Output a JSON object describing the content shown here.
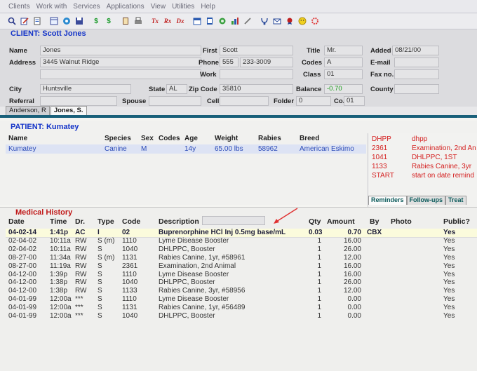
{
  "menu": [
    "Clients",
    "Work with",
    "Services",
    "Applications",
    "View",
    "Utilities",
    "Help"
  ],
  "toolbar": {
    "icons": [
      "search-icon",
      "edit-icon",
      "document-icon",
      "document-icon",
      "save-icon",
      "save-icon",
      "dollar-icon",
      "dollar-icon",
      "book-icon",
      "print-icon",
      "treatment-icon",
      "prescription-icon",
      "diagnosis-icon",
      "calendar-icon",
      "calendar-icon",
      "lab-icon",
      "chart-icon",
      "pen-icon",
      "stethoscope-icon",
      "email-icon",
      "award-icon",
      "smiley-icon",
      "settings-icon"
    ],
    "letters": {
      "s1": "$",
      "s2": "$",
      "tx": "Tx",
      "rx": "Rx",
      "dx": "Dx"
    }
  },
  "client": {
    "section_title": "CLIENT:",
    "client_name": "Scott Jones",
    "labels": {
      "name": "Name",
      "address": "Address",
      "city": "City",
      "state": "State",
      "zip": "Zip Code",
      "referral": "Referral",
      "spouse": "Spouse",
      "first": "First",
      "phone": "Phone",
      "work": "Work",
      "cell": "Cell",
      "title": "Title",
      "codes": "Codes",
      "class": "Class",
      "balance": "Balance",
      "folder": "Folder",
      "co": "Co.",
      "added": "Added",
      "email": "E-mail",
      "fax": "Fax no.",
      "county": "County"
    },
    "values": {
      "name": "Jones",
      "address": "3445 Walnut Ridge",
      "city": "Huntsville",
      "state": "AL",
      "zip": "35810",
      "first": "Scott",
      "phone_area": "555",
      "phone_num": "233-3009",
      "title": "Mr.",
      "codes": "A",
      "class": "01",
      "balance": "-0.70",
      "folder": "0",
      "co": "01",
      "added": "08/21/00"
    },
    "tabs": [
      "Anderson, R",
      "Jones, S."
    ]
  },
  "patient": {
    "section_title": "PATIENT:",
    "patient_name": "Kumatey",
    "headers": {
      "name": "Name",
      "species": "Species",
      "sex": "Sex",
      "codes": "Codes",
      "age": "Age",
      "weight": "Weight",
      "rabies": "Rabies",
      "breed": "Breed"
    },
    "row": {
      "name": "Kumatey",
      "species": "Canine",
      "sex": "M",
      "age": "14y",
      "weight": "65.00 lbs",
      "rabies": "58962",
      "breed": "American Eskimo"
    }
  },
  "reminders": {
    "items": [
      {
        "code": "DHPP",
        "desc": "dhpp"
      },
      {
        "code": "2361",
        "desc": "Examination, 2nd An"
      },
      {
        "code": "1041",
        "desc": "DHLPPC, 1ST"
      },
      {
        "code": "1133",
        "desc": "Rabies Canine, 3yr"
      },
      {
        "code": "START",
        "desc": "start on date remind"
      }
    ],
    "tabs": [
      "Reminders",
      "Follow-ups",
      "Treat"
    ]
  },
  "history": {
    "section_title": "Medical History",
    "headers": {
      "date": "Date",
      "time": "Time",
      "dr": "Dr.",
      "type": "Type",
      "code": "Code",
      "desc": "Description",
      "qty": "Qty",
      "amount": "Amount",
      "by": "By",
      "photo": "Photo",
      "public": "Public?"
    },
    "rows": [
      {
        "date": "04-02-14",
        "time": "1:41p",
        "dr": "AC",
        "type": "I",
        "code": "02",
        "desc": "Buprenorphine HCl Inj 0.5mg base/mL",
        "qty": "0.03",
        "amount": "0.70",
        "by": "CBX",
        "public": "Yes"
      },
      {
        "date": "02-04-02",
        "time": "10:11a",
        "dr": "RW",
        "type": "S (m)",
        "code": "1110",
        "desc": "Lyme Disease Booster",
        "qty": "1",
        "amount": "16.00",
        "by": "",
        "public": "Yes"
      },
      {
        "date": "02-04-02",
        "time": "10:11a",
        "dr": "RW",
        "type": "S",
        "code": "1040",
        "desc": "DHLPPC, Booster",
        "qty": "1",
        "amount": "26.00",
        "by": "",
        "public": "Yes"
      },
      {
        "date": "08-27-00",
        "time": "11:34a",
        "dr": "RW",
        "type": "S (m)",
        "code": "1131",
        "desc": "Rabies Canine, 1yr, #58961",
        "qty": "1",
        "amount": "12.00",
        "by": "",
        "public": "Yes"
      },
      {
        "date": "08-27-00",
        "time": "11:19a",
        "dr": "RW",
        "type": "S",
        "code": "2361",
        "desc": "Examination, 2nd Animal",
        "qty": "1",
        "amount": "16.00",
        "by": "",
        "public": "Yes"
      },
      {
        "date": "04-12-00",
        "time": "1:39p",
        "dr": "RW",
        "type": "S",
        "code": "1110",
        "desc": "Lyme Disease Booster",
        "qty": "1",
        "amount": "16.00",
        "by": "",
        "public": "Yes"
      },
      {
        "date": "04-12-00",
        "time": "1:38p",
        "dr": "RW",
        "type": "S",
        "code": "1040",
        "desc": "DHLPPC, Booster",
        "qty": "1",
        "amount": "26.00",
        "by": "",
        "public": "Yes"
      },
      {
        "date": "04-12-00",
        "time": "1:38p",
        "dr": "RW",
        "type": "S",
        "code": "1133",
        "desc": "Rabies Canine, 3yr, #58956",
        "qty": "1",
        "amount": "12.00",
        "by": "",
        "public": "Yes"
      },
      {
        "date": "04-01-99",
        "time": "12:00a",
        "dr": "***",
        "type": "S",
        "code": "1110",
        "desc": "Lyme Disease Booster",
        "qty": "1",
        "amount": "0.00",
        "by": "",
        "public": "Yes"
      },
      {
        "date": "04-01-99",
        "time": "12:00a",
        "dr": "***",
        "type": "S",
        "code": "1131",
        "desc": "Rabies Canine, 1yr, #56489",
        "qty": "1",
        "amount": "0.00",
        "by": "",
        "public": "Yes"
      },
      {
        "date": "04-01-99",
        "time": "12:00a",
        "dr": "***",
        "type": "S",
        "code": "1040",
        "desc": "DHLPPC, Booster",
        "qty": "1",
        "amount": "0.00",
        "by": "",
        "public": "Yes"
      }
    ]
  },
  "colors": {
    "accent_blue": "#1434c8",
    "balance_green": "#1a9a1a",
    "reminder_red": "#d42020",
    "annotation_arrow": "#e03030",
    "tab_strip": "#19607a"
  }
}
